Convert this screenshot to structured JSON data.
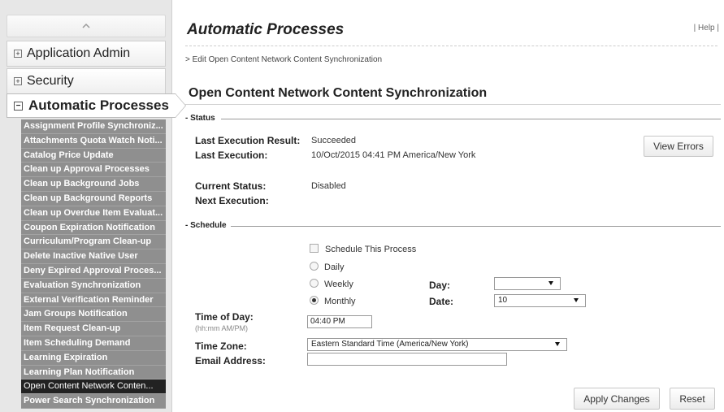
{
  "sidebar": {
    "collapse_icon": "chevron-up-icon",
    "items": [
      {
        "label": "Application Admin",
        "icon": "plus-box-icon"
      },
      {
        "label": "Security",
        "icon": "plus-box-icon"
      }
    ],
    "active": {
      "label": "Automatic Processes",
      "icon": "minus-box-icon"
    },
    "subitems": [
      "Assignment Profile Synchroniz...",
      "Attachments Quota Watch Noti...",
      "Catalog Price Update",
      "Clean up Approval Processes",
      "Clean up Background Jobs",
      "Clean up Background Reports",
      "Clean up Overdue Item Evaluat...",
      "Coupon Expiration Notification",
      "Curriculum/Program Clean-up",
      "Delete Inactive Native User",
      "Deny Expired Approval Proces...",
      "Evaluation Synchronization",
      "External Verification Reminder",
      "Jam Groups Notification",
      "Item Request Clean-up",
      "Item Scheduling Demand",
      "Learning Expiration",
      "Learning Plan Notification",
      "Open Content Network Conten...",
      "Power Search Synchronization"
    ],
    "selected_index": 18
  },
  "header": {
    "title": "Automatic Processes",
    "help": "| Help |",
    "breadcrumb": "> Edit Open Content Network Content Synchronization"
  },
  "main": {
    "section_title": "Open Content Network Content Synchronization",
    "status": {
      "legend": "Status",
      "last_result_label": "Last Execution Result:",
      "last_result_value": "Succeeded",
      "last_exec_label": "Last Execution:",
      "last_exec_value": "10/Oct/2015 04:41 PM America/New York",
      "view_errors": "View Errors",
      "current_status_label": "Current Status:",
      "current_status_value": "Disabled",
      "next_exec_label": "Next Execution:"
    },
    "schedule": {
      "legend": "Schedule",
      "schedule_this": "Schedule This Process",
      "daily": "Daily",
      "weekly": "Weekly",
      "monthly": "Monthly",
      "day_label": "Day:",
      "day_value": "",
      "date_label": "Date:",
      "date_value": "10",
      "time_label": "Time of Day:",
      "time_hint": "(hh:mm AM/PM)",
      "time_value": "04:40 PM",
      "tz_label": "Time Zone:",
      "tz_value": "Eastern Standard Time (America/New York)",
      "email_label": "Email Address:",
      "email_value": ""
    },
    "buttons": {
      "apply": "Apply Changes",
      "reset": "Reset"
    }
  }
}
